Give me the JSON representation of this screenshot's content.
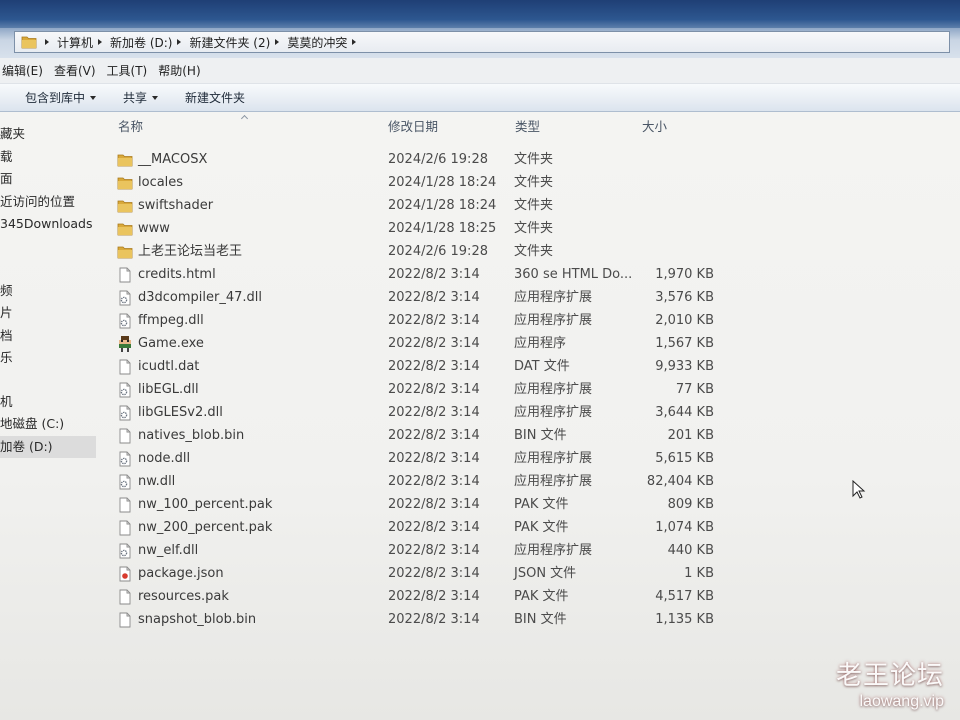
{
  "address": {
    "segments": [
      "计算机",
      "新加卷 (D:)",
      "新建文件夹 (2)",
      "莫莫的冲突"
    ]
  },
  "menu": [
    "编辑(E)",
    "查看(V)",
    "工具(T)",
    "帮助(H)"
  ],
  "toolbar": {
    "include_in_library": "包含到库中",
    "share": "共享",
    "new_folder": "新建文件夹"
  },
  "sidebar": {
    "groups": [
      {
        "items": [
          {
            "label": "藏夹"
          },
          {
            "label": "载"
          },
          {
            "label": "面"
          },
          {
            "label": "近访问的位置"
          },
          {
            "label": "345Downloads"
          }
        ]
      },
      {
        "items": [
          {
            "label": "频"
          },
          {
            "label": "片"
          },
          {
            "label": "档"
          },
          {
            "label": "乐"
          }
        ]
      },
      {
        "items": [
          {
            "label": "机"
          },
          {
            "label": "地磁盘 (C:)"
          },
          {
            "label": "加卷 (D:)",
            "selected": true
          }
        ]
      }
    ]
  },
  "columns": {
    "name": "名称",
    "date": "修改日期",
    "type": "类型",
    "size": "大小"
  },
  "files": [
    {
      "name": "__MACOSX",
      "date": "2024/2/6 19:28",
      "type": "文件夹",
      "icon": "folder-icon"
    },
    {
      "name": "locales",
      "date": "2024/1/28 18:24",
      "type": "文件夹",
      "icon": "folder-icon"
    },
    {
      "name": "swiftshader",
      "date": "2024/1/28 18:24",
      "type": "文件夹",
      "icon": "folder-icon"
    },
    {
      "name": "www",
      "date": "2024/1/28 18:25",
      "type": "文件夹",
      "icon": "folder-icon"
    },
    {
      "name": "上老王论坛当老王",
      "date": "2024/2/6 19:28",
      "type": "文件夹",
      "icon": "folder-icon"
    },
    {
      "name": "credits.html",
      "date": "2022/8/2 3:14",
      "type": "360 se HTML Do...",
      "size": "1,970 KB",
      "icon": "document-icon"
    },
    {
      "name": "d3dcompiler_47.dll",
      "date": "2022/8/2 3:14",
      "type": "应用程序扩展",
      "size": "3,576 KB",
      "icon": "dll-file-icon"
    },
    {
      "name": "ffmpeg.dll",
      "date": "2022/8/2 3:14",
      "type": "应用程序扩展",
      "size": "2,010 KB",
      "icon": "dll-file-icon"
    },
    {
      "name": "Game.exe",
      "date": "2022/8/2 3:14",
      "type": "应用程序",
      "size": "1,567 KB",
      "icon": "game-exe-icon"
    },
    {
      "name": "icudtl.dat",
      "date": "2022/8/2 3:14",
      "type": "DAT 文件",
      "size": "9,933 KB",
      "icon": "document-icon"
    },
    {
      "name": "libEGL.dll",
      "date": "2022/8/2 3:14",
      "type": "应用程序扩展",
      "size": "77 KB",
      "icon": "dll-file-icon"
    },
    {
      "name": "libGLESv2.dll",
      "date": "2022/8/2 3:14",
      "type": "应用程序扩展",
      "size": "3,644 KB",
      "icon": "dll-file-icon"
    },
    {
      "name": "natives_blob.bin",
      "date": "2022/8/2 3:14",
      "type": "BIN 文件",
      "size": "201 KB",
      "icon": "document-icon"
    },
    {
      "name": "node.dll",
      "date": "2022/8/2 3:14",
      "type": "应用程序扩展",
      "size": "5,615 KB",
      "icon": "dll-file-icon"
    },
    {
      "name": "nw.dll",
      "date": "2022/8/2 3:14",
      "type": "应用程序扩展",
      "size": "82,404 KB",
      "icon": "dll-file-icon"
    },
    {
      "name": "nw_100_percent.pak",
      "date": "2022/8/2 3:14",
      "type": "PAK 文件",
      "size": "809 KB",
      "icon": "document-icon"
    },
    {
      "name": "nw_200_percent.pak",
      "date": "2022/8/2 3:14",
      "type": "PAK 文件",
      "size": "1,074 KB",
      "icon": "document-icon"
    },
    {
      "name": "nw_elf.dll",
      "date": "2022/8/2 3:14",
      "type": "应用程序扩展",
      "size": "440 KB",
      "icon": "dll-file-icon"
    },
    {
      "name": "package.json",
      "date": "2022/8/2 3:14",
      "type": "JSON 文件",
      "size": "1 KB",
      "icon": "json-file-icon"
    },
    {
      "name": "resources.pak",
      "date": "2022/8/2 3:14",
      "type": "PAK 文件",
      "size": "4,517 KB",
      "icon": "document-icon"
    },
    {
      "name": "snapshot_blob.bin",
      "date": "2022/8/2 3:14",
      "type": "BIN 文件",
      "size": "1,135 KB",
      "icon": "document-icon"
    }
  ],
  "watermark": {
    "title": "老王论坛",
    "site": "laowang.vip"
  },
  "colors": {
    "title_bar": "#1f3f75",
    "folder": "#d9a93a",
    "selection": "#dcdcdc",
    "text": "#3b3b3b"
  }
}
